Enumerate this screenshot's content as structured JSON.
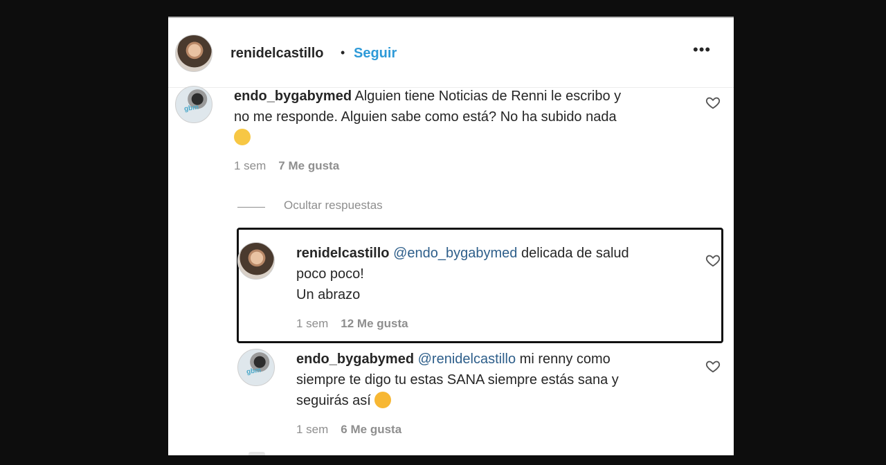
{
  "header": {
    "username": "renidelcastillo",
    "separator": "•",
    "follow_label": "Seguir",
    "more_label": "•••"
  },
  "comments": [
    {
      "username": "endo_bygabymed",
      "lines": [
        "Alguien tiene Noticias de Renni le escribo y",
        "no me responde. Alguien sabe como está? No ha subido nada"
      ],
      "emoji": "flushed-face-emoji",
      "time": "1 sem",
      "likes": "7 Me gusta"
    }
  ],
  "replies_toggle": "Ocultar respuestas",
  "replies": [
    {
      "username": "renidelcastillo",
      "mention": "@endo_bygabymed",
      "lines": [
        "delicada de salud",
        "poco poco!",
        "Un abrazo"
      ],
      "time": "1 sem",
      "likes": "12 Me gusta"
    },
    {
      "username": "endo_bygabymed",
      "mention": "@renidelcastillo",
      "lines": [
        "mi renny como",
        "siempre te digo tu estas SANA siempre estás sana y",
        "seguirás así"
      ],
      "emoji": "smiling-face-with-heart-eyes-emoji",
      "time": "1 sem",
      "likes": "6 Me gusta"
    }
  ],
  "colors": {
    "follow": "#2e9ad8",
    "mention": "#2d5e8a",
    "meta": "#8e8e8e",
    "background": "#0d0d0d"
  }
}
